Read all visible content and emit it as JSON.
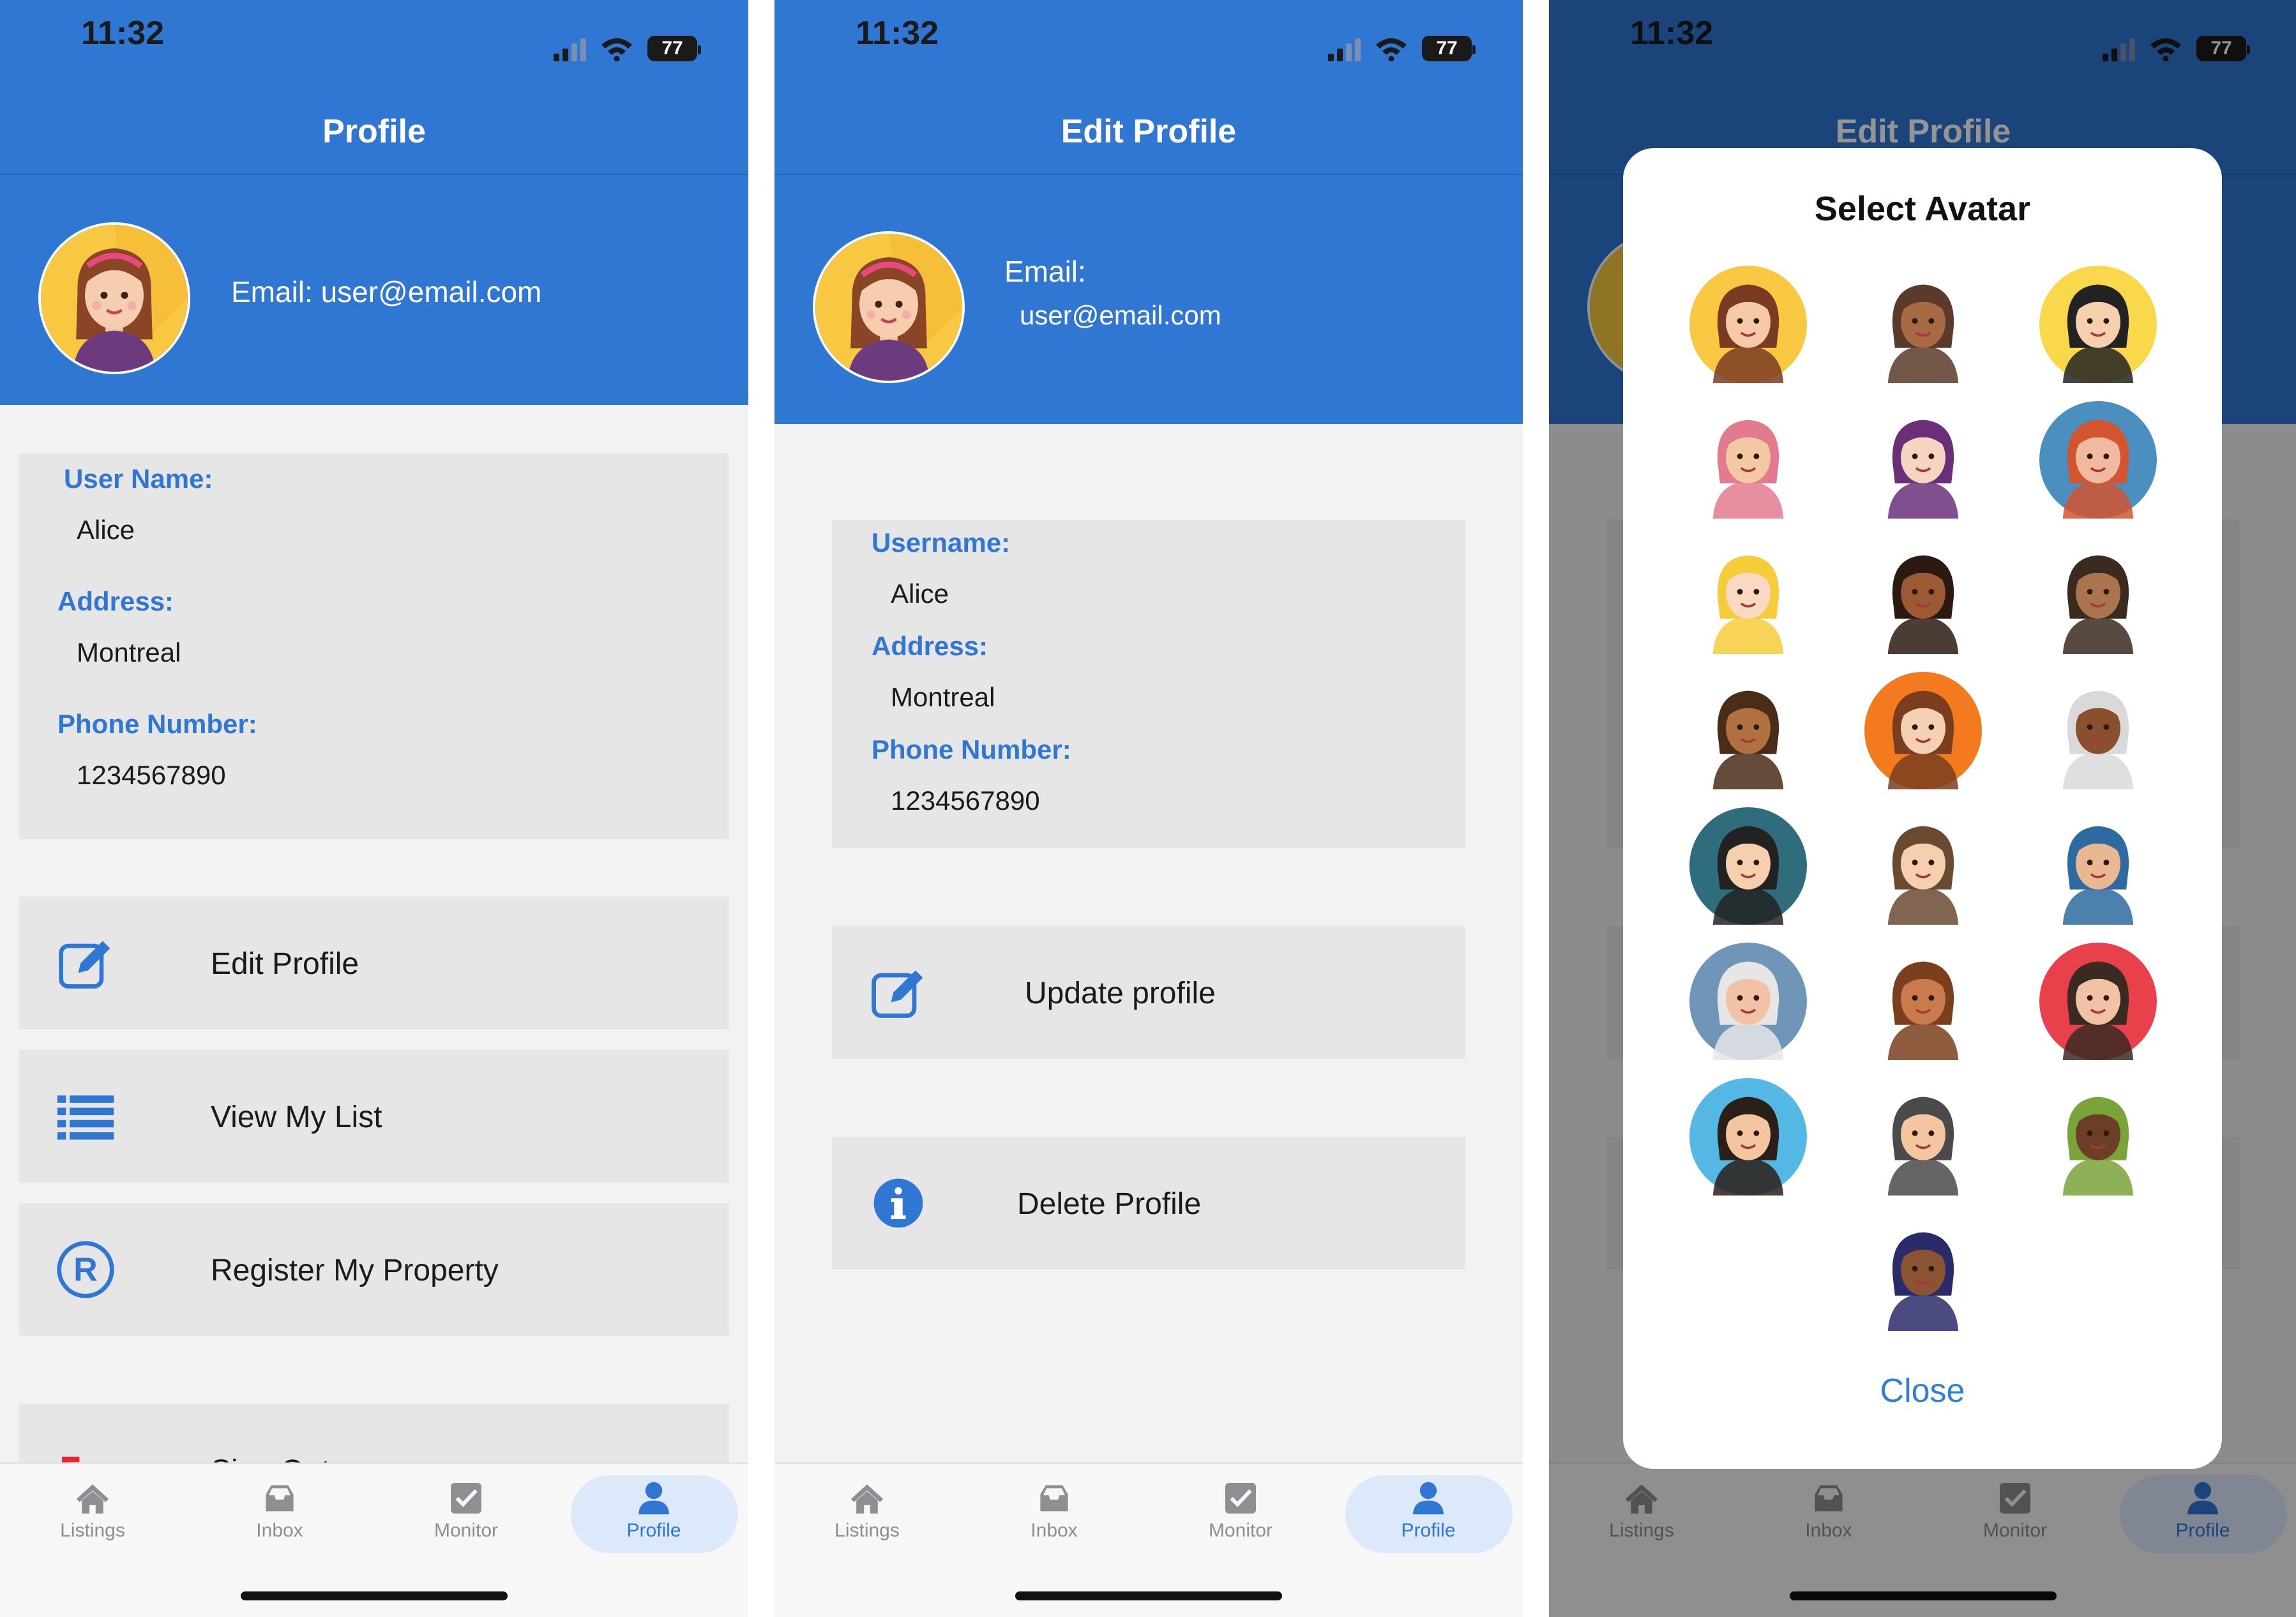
{
  "status_bar": {
    "time": "11:32",
    "battery": "77"
  },
  "screen1": {
    "nav_title": "Profile",
    "email_text": "Email: user@email.com",
    "fields": [
      {
        "label": "User Name:",
        "value": "Alice"
      },
      {
        "label": "Address:",
        "value": "Montreal"
      },
      {
        "label": "Phone Number:",
        "value": "1234567890"
      }
    ],
    "actions": [
      {
        "label": "Edit Profile",
        "icon": "edit-icon"
      },
      {
        "label": "View My List",
        "icon": "list-icon"
      },
      {
        "label": "Register My Property",
        "icon": "registered-icon"
      },
      {
        "label": "Sign Out",
        "icon": "sign-out-icon"
      }
    ]
  },
  "screen2": {
    "nav_title": "Edit Profile",
    "email_label": "Email:",
    "email_value": "user@email.com",
    "fields": [
      {
        "label": "Username:",
        "value": "Alice"
      },
      {
        "label": "Address:",
        "value": "Montreal"
      },
      {
        "label": "Phone Number:",
        "value": "1234567890"
      }
    ],
    "actions": [
      {
        "label": "Update profile",
        "icon": "edit-icon"
      },
      {
        "label": "Delete Profile",
        "icon": "info-icon"
      }
    ]
  },
  "screen3": {
    "nav_title": "Edit Profile",
    "modal_title": "Select Avatar",
    "close_label": "Close",
    "avatars": [
      {
        "name": "avatar-1",
        "bg": "#f9c843",
        "skin": "#f6c9a8",
        "hair": "#7a3b22"
      },
      {
        "name": "avatar-2",
        "bg": "#ffffff",
        "skin": "#a86a45",
        "hair": "#5a3a2a"
      },
      {
        "name": "avatar-3",
        "bg": "#f9d94b",
        "skin": "#f5cfae",
        "hair": "#222222"
      },
      {
        "name": "avatar-4",
        "bg": "#ffffff",
        "skin": "#f3c9a5",
        "hair": "#e37b8f"
      },
      {
        "name": "avatar-5",
        "bg": "#ffffff",
        "skin": "#f6d5c2",
        "hair": "#6b2f7a"
      },
      {
        "name": "avatar-6",
        "bg": "#4b8fc0",
        "skin": "#f1b9a0",
        "hair": "#d2552f"
      },
      {
        "name": "avatar-7",
        "bg": "#ffffff",
        "skin": "#f9d9c1",
        "hair": "#f6cc3a"
      },
      {
        "name": "avatar-8",
        "bg": "#ffffff",
        "skin": "#9b5a34",
        "hair": "#2b1a12"
      },
      {
        "name": "avatar-9",
        "bg": "#ffffff",
        "skin": "#a9744e",
        "hair": "#3a2a1f"
      },
      {
        "name": "avatar-10",
        "bg": "#ffffff",
        "skin": "#b0703f",
        "hair": "#4a2d18"
      },
      {
        "name": "avatar-11",
        "bg": "#f37a1f",
        "skin": "#f6d0b2",
        "hair": "#7a3e1e"
      },
      {
        "name": "avatar-12",
        "bg": "#ffffff",
        "skin": "#8a4f2d",
        "hair": "#d9d9d9"
      },
      {
        "name": "avatar-13",
        "bg": "#2f6d7d",
        "skin": "#f5cfae",
        "hair": "#222222"
      },
      {
        "name": "avatar-14",
        "bg": "#ffffff",
        "skin": "#f5cfae",
        "hair": "#6b4a32"
      },
      {
        "name": "avatar-15",
        "bg": "#ffffff",
        "skin": "#e9b892",
        "hair": "#2d6a9f"
      },
      {
        "name": "avatar-16",
        "bg": "#6f95b8",
        "skin": "#f1c2a5",
        "hair": "#e6e6e6"
      },
      {
        "name": "avatar-17",
        "bg": "#ffffff",
        "skin": "#c97b4d",
        "hair": "#7b3f1e"
      },
      {
        "name": "avatar-18",
        "bg": "#e8414b",
        "skin": "#f1c2a5",
        "hair": "#3b2a22"
      },
      {
        "name": "avatar-19",
        "bg": "#55b7e3",
        "skin": "#f3c6a0",
        "hair": "#2b1f18"
      },
      {
        "name": "avatar-20",
        "bg": "#ffffff",
        "skin": "#f3c6a0",
        "hair": "#4a4a4a"
      },
      {
        "name": "avatar-21",
        "bg": "#ffffff",
        "skin": "#6b3f27",
        "hair": "#7aa33a"
      },
      {
        "name": "avatar-22",
        "bg": "#ffffff",
        "skin": "#8a5332",
        "hair": "#2b2a6b"
      }
    ]
  },
  "tabs": [
    {
      "label": "Listings",
      "icon": "home-icon"
    },
    {
      "label": "Inbox",
      "icon": "inbox-icon"
    },
    {
      "label": "Monitor",
      "icon": "checkbox-icon"
    },
    {
      "label": "Profile",
      "icon": "person-icon"
    }
  ],
  "colors": {
    "accent": "#2f77d3",
    "card": "#e6e6e6",
    "background": "#f2f2f2",
    "link": "#2f7ed8"
  }
}
